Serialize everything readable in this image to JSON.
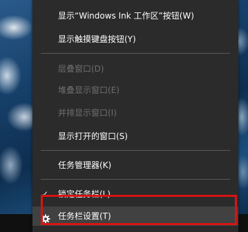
{
  "context_menu": {
    "items": [
      {
        "label": "显示“Windows Ink 工作区”按钮(W)",
        "enabled": true
      },
      {
        "label": "显示触摸键盘按钮(Y)",
        "enabled": true
      },
      {
        "label": "层叠窗口(D)",
        "enabled": false
      },
      {
        "label": "堆叠显示窗口(E)",
        "enabled": false
      },
      {
        "label": "并排显示窗口(I)",
        "enabled": false
      },
      {
        "label": "显示打开的窗口(S)",
        "enabled": true
      },
      {
        "label": "任务管理器(K)",
        "enabled": true
      },
      {
        "label": "锁定任务栏(L)",
        "enabled": true,
        "checked": true,
        "check_icon": "✓"
      },
      {
        "label": "任务栏设置(T)",
        "enabled": true,
        "icon": "gear-icon",
        "hovered": true
      }
    ]
  },
  "colors": {
    "menu_background": "#2b2b2b",
    "hover_background": "#414141",
    "text": "#ffffff",
    "disabled_text": "#6f6f6f",
    "highlight_border": "#d81414"
  }
}
